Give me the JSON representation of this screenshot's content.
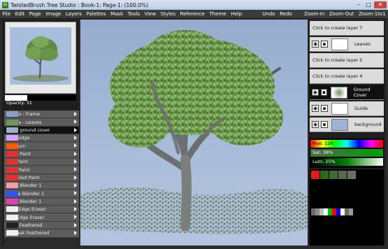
{
  "window": {
    "title": "TwistedBrush Tree Studio : Book-1: Page-1: (100.0%)"
  },
  "menu": {
    "left": [
      "File",
      "Edit",
      "Page",
      "Image",
      "Layers",
      "Palettes",
      "Mask",
      "Tools",
      "View",
      "Styles",
      "Reference",
      "Theme",
      "Help"
    ],
    "right": [
      "Undo",
      "Redo",
      "Zoom-In",
      "Zoom-Out",
      "Zoom-1to1"
    ]
  },
  "page_panel": {
    "opacity_label": "Opacity: 31",
    "opacity_value": 31
  },
  "brushes": [
    {
      "label": "Acacia - Frame",
      "color": "#8aa0c8"
    },
    {
      "label": "Acacia - Leaves",
      "color": "#6f9a55"
    },
    {
      "label": "Basic ground cover",
      "color": "#9ab0d0",
      "selected": true
    },
    {
      "label": "Pro Dodge",
      "color": "#d8a0ff"
    },
    {
      "label": "Pro Burn",
      "color": "#ff5a00"
    },
    {
      "label": "Basic Paint",
      "color": "#e53030"
    },
    {
      "label": "Soft Paint",
      "color": "#e53030"
    },
    {
      "label": "Hard Paint",
      "color": "#e53030"
    },
    {
      "label": "Speckled Paint",
      "color": "#e53030"
    },
    {
      "label": "Basic Blender 1",
      "color": "#f0a0a0"
    },
    {
      "label": "Bristle Blender 1",
      "color": "#3050ff"
    },
    {
      "label": "Warp Blender 1",
      "color": "#e040b0"
    },
    {
      "label": "Hard Edge Eraser",
      "color": "#f0f0f0"
    },
    {
      "label": "Soft Edge Eraser",
      "color": "#f0f0f0"
    },
    {
      "label": "Mask Feathered",
      "color": "#222222"
    },
    {
      "label": "Unmask Feathered",
      "color": "#f0f0f0"
    }
  ],
  "layers": [
    {
      "label": "Click to create layer 7",
      "type": "placeholder"
    },
    {
      "label": "Leaves",
      "type": "layer"
    },
    {
      "label": "Click to create layer 5",
      "type": "placeholder"
    },
    {
      "label": "Click to create layer 4",
      "type": "placeholder"
    },
    {
      "label": "Ground Cover",
      "type": "layer",
      "selected": true
    },
    {
      "label": "Guide",
      "type": "layer"
    },
    {
      "label": "background",
      "type": "layer"
    }
  ],
  "color": {
    "hue_label": "Hue: 120",
    "hue": 120,
    "sat_label": "Sat: 38%",
    "sat": 38,
    "lum_label": "Lum: 25%",
    "lum": 25
  },
  "palette": {
    "top_row": [
      "#e11a1a",
      "#2a6b1a",
      "#3f6a36",
      "#556b4b",
      "#6c6c6c"
    ],
    "strip": [
      "#6a6a6a",
      "#8a8a8a",
      "#bdbdbd",
      "#ffffff",
      "#00c000",
      "#ff0000",
      "#0000ff",
      "#ffffff",
      "#6a6a6a",
      "#9a9a9a"
    ]
  },
  "colors": {
    "accent": "#fc0000",
    "menu_bg": "#3b3b3b",
    "panel_bg": "#1e1e1e"
  }
}
